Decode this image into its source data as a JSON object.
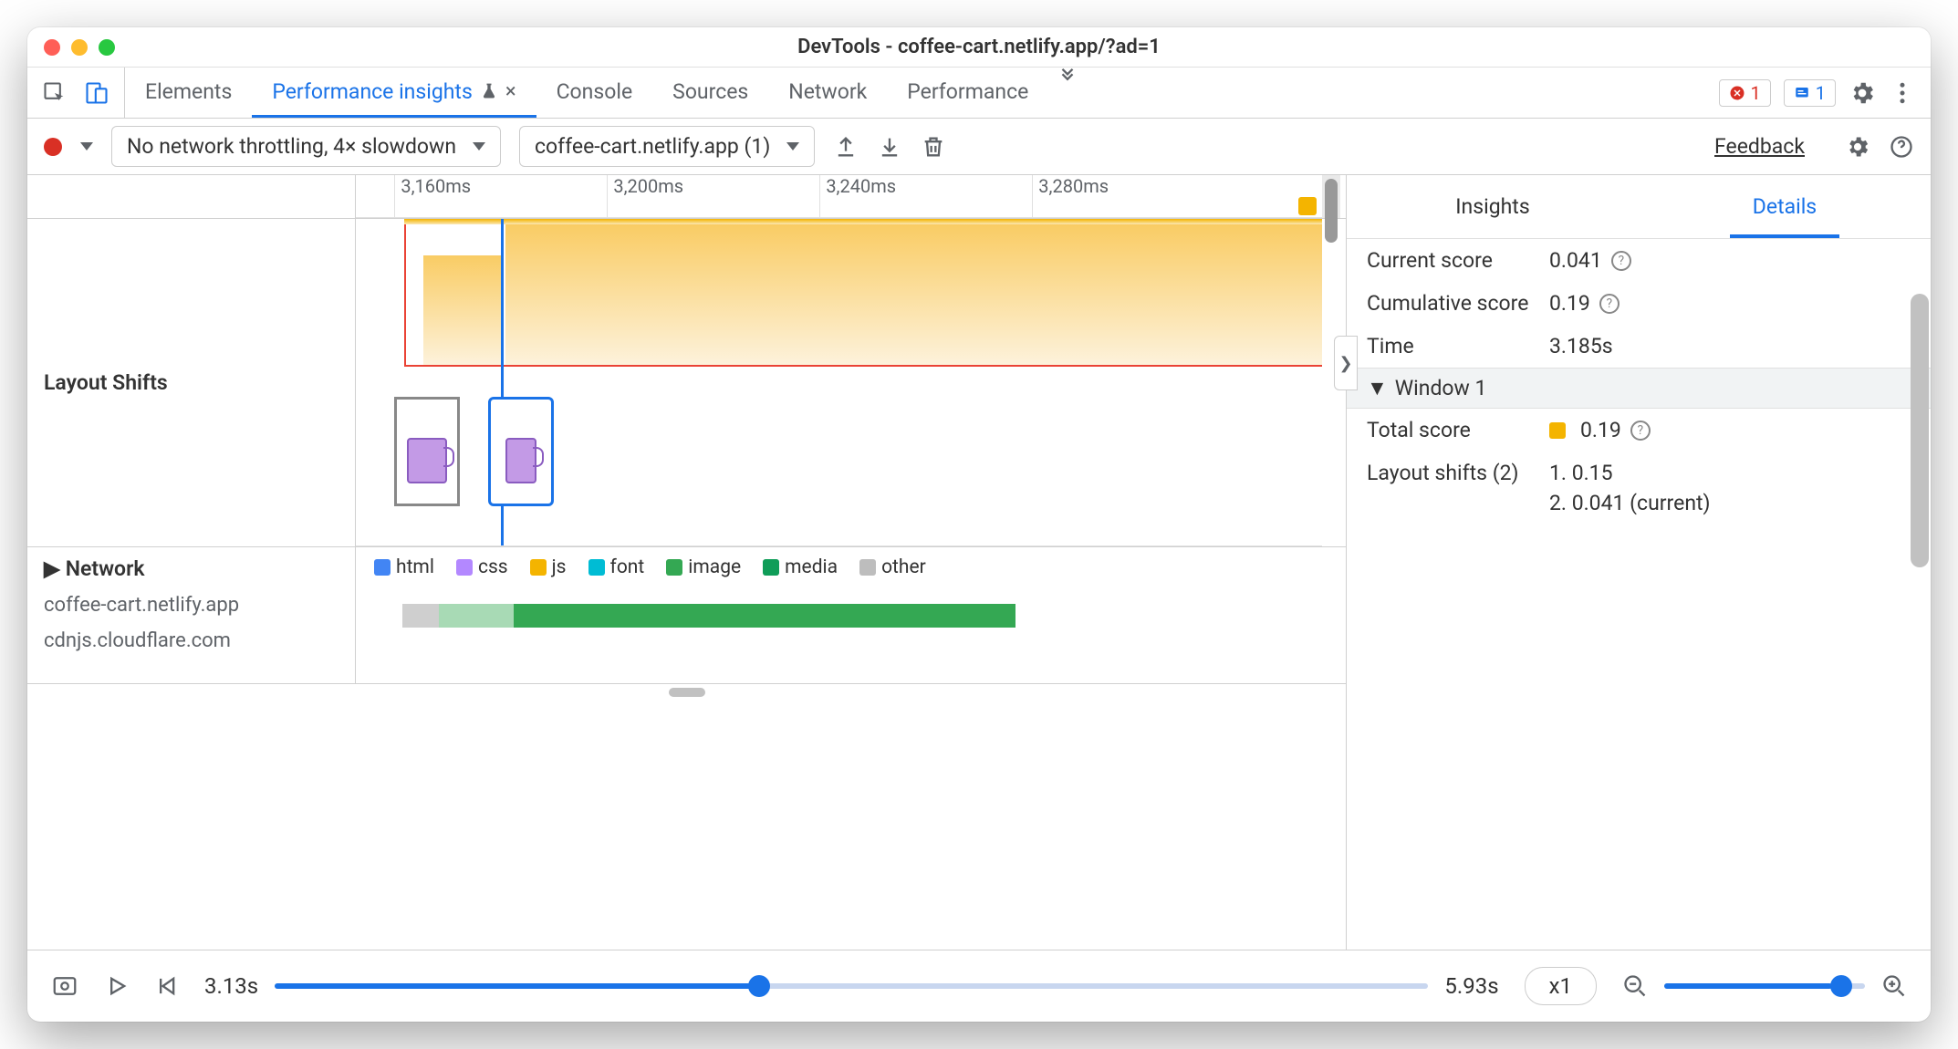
{
  "window": {
    "title": "DevTools - coffee-cart.netlify.app/?ad=1"
  },
  "tabs": {
    "items": [
      "Elements",
      "Performance insights",
      "Console",
      "Sources",
      "Network",
      "Performance"
    ],
    "active_index": 1
  },
  "badges": {
    "errors": "1",
    "issues": "1"
  },
  "toolbar": {
    "throttling": "No network throttling, 4× slowdown",
    "recording": "coffee-cart.netlify.app (1)",
    "feedback": "Feedback"
  },
  "ruler": {
    "ticks": [
      "3,160ms",
      "3,200ms",
      "3,240ms",
      "3,280ms"
    ]
  },
  "layout_shifts_label": "Layout Shifts",
  "network": {
    "label": "Network",
    "hosts": [
      "coffee-cart.netlify.app",
      "cdnjs.cloudflare.com"
    ],
    "legend": [
      {
        "name": "html",
        "color": "#4285f4"
      },
      {
        "name": "css",
        "color": "#b388ff"
      },
      {
        "name": "js",
        "color": "#f4b400"
      },
      {
        "name": "font",
        "color": "#00bcd4"
      },
      {
        "name": "image",
        "color": "#34a853"
      },
      {
        "name": "media",
        "color": "#0f9d58"
      },
      {
        "name": "other",
        "color": "#bdbdbd"
      }
    ]
  },
  "details": {
    "tabs": [
      "Insights",
      "Details"
    ],
    "active_index": 1,
    "current_score": {
      "label": "Current score",
      "value": "0.041"
    },
    "cumulative_score": {
      "label": "Cumulative score",
      "value": "0.19"
    },
    "time": {
      "label": "Time",
      "value": "3.185s"
    },
    "window_head": "Window 1",
    "total_score": {
      "label": "Total score",
      "value": "0.19"
    },
    "shifts": {
      "label": "Layout shifts (2)",
      "items": [
        "1. 0.15",
        "2. 0.041 (current)"
      ]
    }
  },
  "footer": {
    "range_start": "3.13s",
    "range_end": "5.93s",
    "speed": "x1"
  }
}
